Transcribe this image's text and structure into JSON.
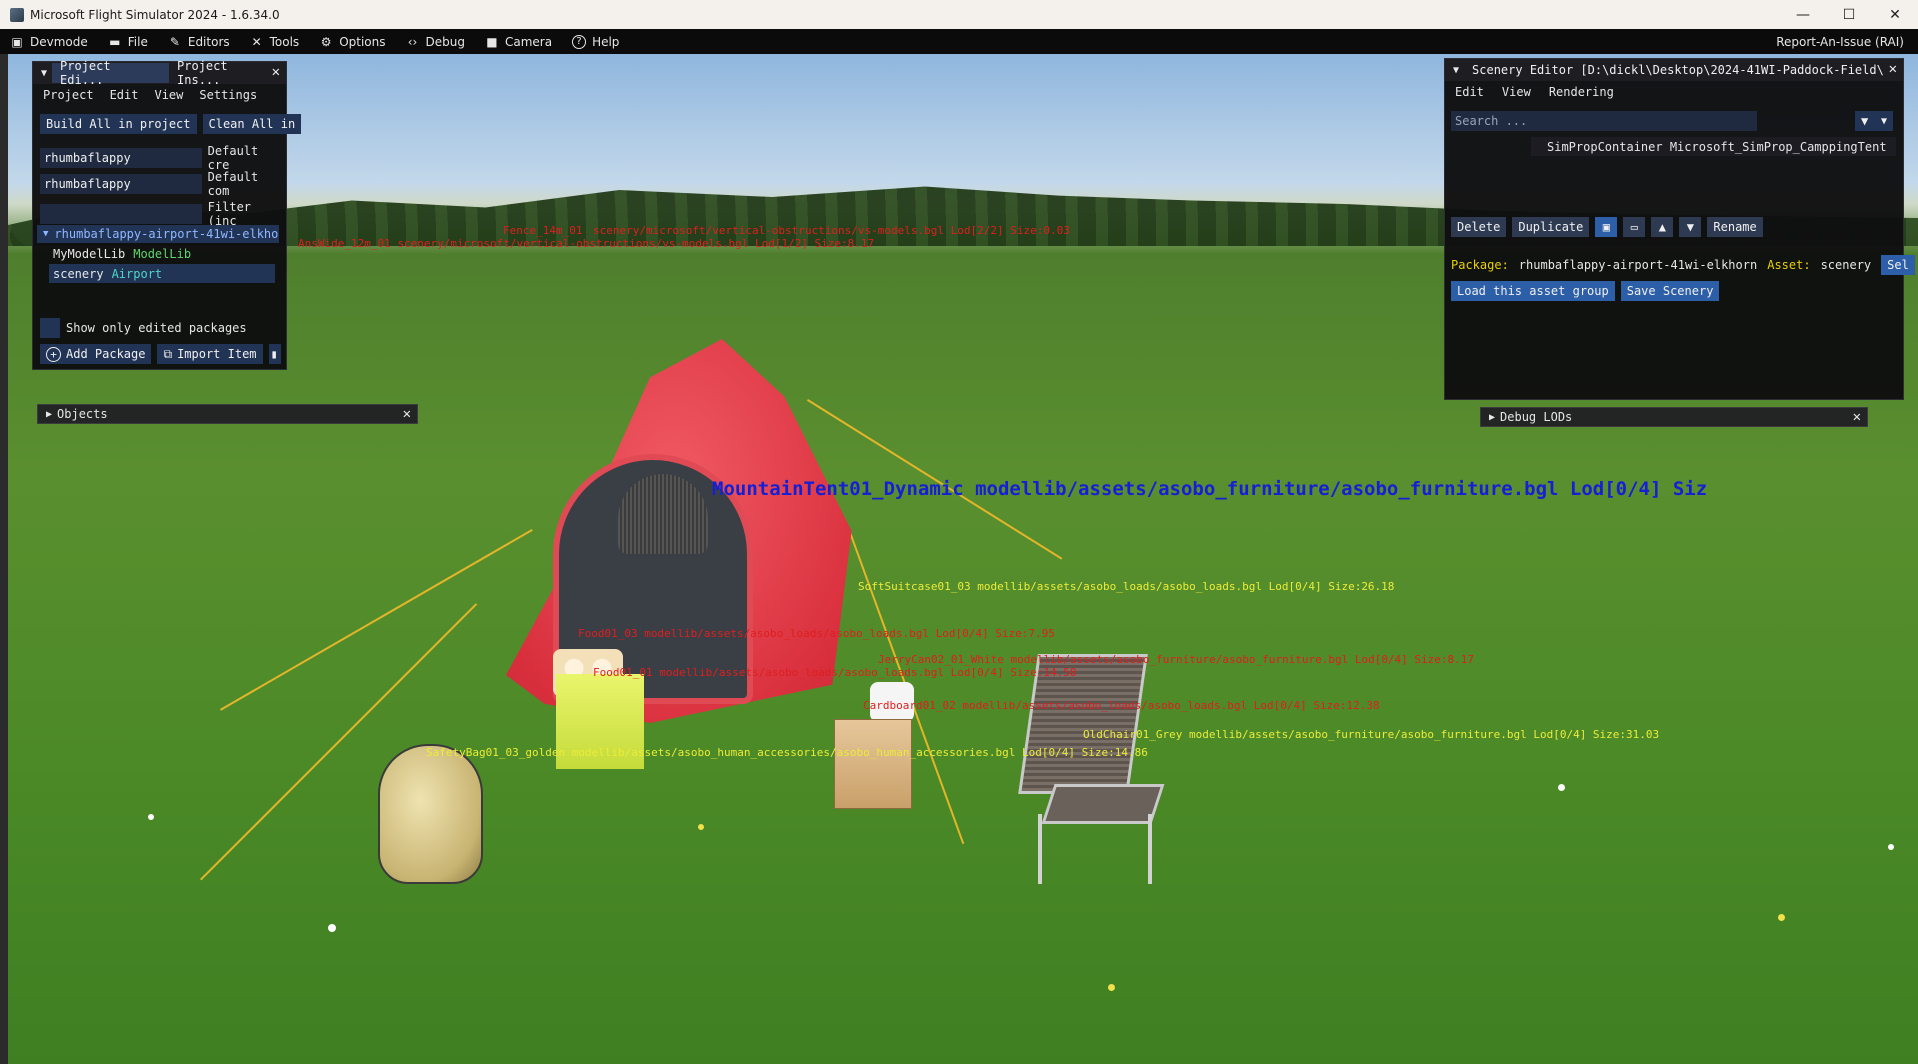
{
  "window": {
    "title": "Microsoft Flight Simulator 2024 - 1.6.34.0",
    "controls": {
      "minimize": "—",
      "maximize": "☐",
      "close": "✕"
    }
  },
  "menubar": {
    "items": [
      {
        "label": "Devmode",
        "icon": "devmode-icon"
      },
      {
        "label": "File",
        "icon": "folder-icon"
      },
      {
        "label": "Editors",
        "icon": "pencil-icon"
      },
      {
        "label": "Tools",
        "icon": "tools-icon"
      },
      {
        "label": "Options",
        "icon": "gear-icon"
      },
      {
        "label": "Debug",
        "icon": "code-icon"
      },
      {
        "label": "Camera",
        "icon": "camera-icon"
      },
      {
        "label": "Help",
        "icon": "help-icon"
      }
    ],
    "report": "Report-An-Issue (RAI)"
  },
  "project_panel": {
    "tabs": [
      "Project Edi...",
      "Project Ins..."
    ],
    "menu": [
      "Project",
      "Edit",
      "View",
      "Settings"
    ],
    "build_all": "Build All in project",
    "clean_all": "Clean All in",
    "rows": [
      {
        "value": "rhumbaflappy",
        "label": "Default cre"
      },
      {
        "value": "rhumbaflappy",
        "label": "Default com"
      }
    ],
    "filter_label": "Filter (inc",
    "tree": {
      "package": "rhumbaflappy-airport-41wi-elkho",
      "children": [
        {
          "name": "MyModelLib",
          "type": "ModelLib"
        },
        {
          "name": "scenery",
          "type": "Airport"
        }
      ]
    },
    "show_only_edited": "Show only edited packages",
    "add_package": "Add Package",
    "import_item": "Import Item"
  },
  "objects_bar": {
    "label": "Objects"
  },
  "scenery_panel": {
    "title": "Scenery Editor [D:\\dickl\\Desktop\\2024-41WI-Paddock-Field\\",
    "menu": [
      "Edit",
      "View",
      "Rendering"
    ],
    "search_placeholder": "Search ...",
    "tree_item": "SimPropContainer Microsoft_SimProp_CamppingTent",
    "toolbar": {
      "delete": "Delete",
      "duplicate": "Duplicate",
      "rename": "Rename"
    },
    "package_label": "Package:",
    "package_value": "rhumbaflappy-airport-41wi-elkhorn",
    "asset_label": "Asset:",
    "asset_value": "scenery",
    "select": "Sel",
    "load_group": "Load this asset group",
    "save_scenery": "Save Scenery"
  },
  "debug_lods_bar": {
    "label": "Debug LODs"
  },
  "overlay": {
    "tent": "MountainTent01_Dynamic   modellib/assets/asobo_furniture/asobo_furniture.bgl  Lod[0/4]  Siz",
    "far1": "scenery/microsoft/vertical-obstructions/vs-models.bgl  Lod[2/2]  Size:0.03",
    "far1_name": "Fence_14m_01",
    "far2": "AnsWide_12m_01   scenery/microsoft/vertical-obstructions/vs-models.bgl  Lod[1/2]  Size:8.17",
    "suitcase": "SoftSuitcase01_03   modellib/assets/asobo_loads/asobo_loads.bgl  Lod[0/4]  Size:26.18",
    "food03": "Food01_03   modellib/assets/asobo_loads/asobo_loads.bgl  Lod[0/4]  Size:7.95",
    "jerry": "JerryCan02_01_White   modellib/assets/asobo_furniture/asobo_furniture.bgl  Lod[0/4]  Size:8.17",
    "food01": "Food01_01   modellib/assets/asobo_loads/asobo_loads.bgl  Lod[0/4]  Size:14.58",
    "cardboard": "Cardboard01_02   modellib/assets/asobo_loads/asobo_loads.bgl  Lod[0/4]  Size:12.38",
    "chair": "OldChair01_Grey   modellib/assets/asobo_furniture/asobo_furniture.bgl  Lod[0/4]  Size:31.03",
    "bag": "SafetyBag01_03_golden   modellib/assets/asobo_human_accessories/asobo_human_accessories.bgl  Lod[0/4]  Size:14.86"
  }
}
